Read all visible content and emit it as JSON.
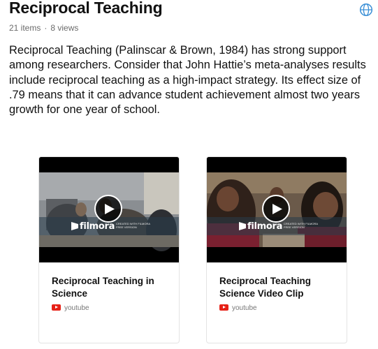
{
  "collection": {
    "title": "Reciprocal Teaching",
    "items_count": "21 items",
    "separator": "·",
    "views_count": "8 views",
    "description": "Reciprocal Teaching (Palinscar & Brown, 1984) has strong support among researchers. Consider that John Hattie’s meta-analyses results include reciprocal teaching as a high-impact strategy. Its effect size of .79 means that it can advance student achievement almost two years growth for one year of school."
  },
  "cards": [
    {
      "title": "Reciprocal Teaching in Science",
      "source": "youtube",
      "watermark": "filmora",
      "watermark_sub": "CREATED WITH FILMORA FREE VERSION"
    },
    {
      "title": "Reciprocal Teaching Science Video Clip",
      "source": "youtube",
      "watermark": "filmora",
      "watermark_sub": "CREATED WITH FILMORA FREE VERSION"
    }
  ],
  "icons": {
    "share": "globe-icon",
    "play": "play-icon",
    "source": "youtube-icon"
  },
  "colors": {
    "youtube": "#e62117",
    "text": "#111111",
    "meta": "#6b6b6b"
  }
}
